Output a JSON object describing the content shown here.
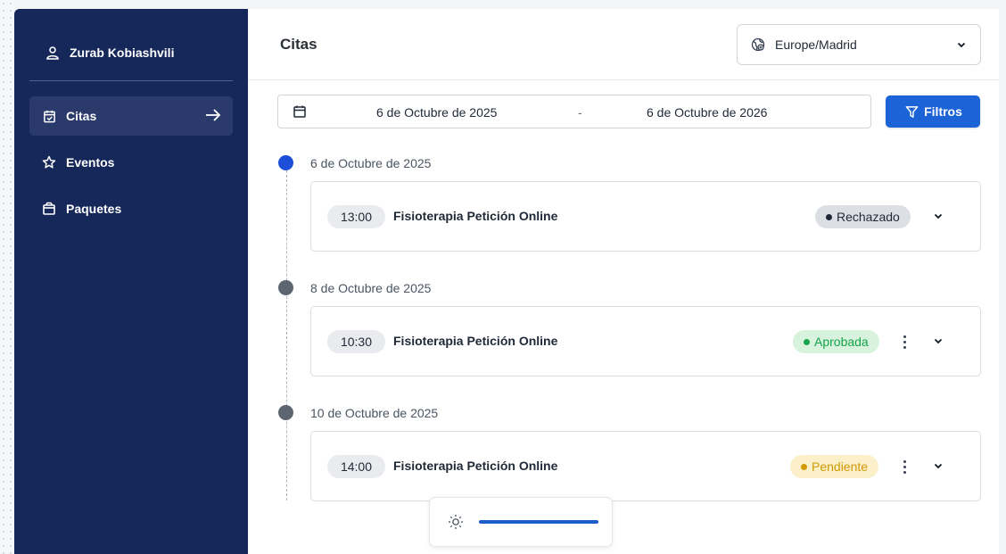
{
  "sidebar": {
    "user_name": "Zurab Kobiashvili",
    "items": [
      {
        "label": "Citas",
        "icon": "calendar-check-icon",
        "active": true
      },
      {
        "label": "Eventos",
        "icon": "star-icon",
        "active": false
      },
      {
        "label": "Paquetes",
        "icon": "package-icon",
        "active": false
      }
    ]
  },
  "header": {
    "title": "Citas",
    "timezone": "Europe/Madrid"
  },
  "filters": {
    "date_from": "6 de Octubre de 2025",
    "separator": "-",
    "date_to": "6 de Octubre de 2026",
    "filter_label": "Filtros"
  },
  "timeline": [
    {
      "date": "6 de Octubre de 2025",
      "time": "13:00",
      "title": "Fisioterapia Petición Online",
      "status": "Rechazado"
    },
    {
      "date": "8 de Octubre de 2025",
      "time": "10:30",
      "title": "Fisioterapia Petición Online",
      "status": "Aprobada"
    },
    {
      "date": "10 de Octubre de 2025",
      "time": "14:00",
      "title": "Fisioterapia Petición Online",
      "status": "Pendiente"
    }
  ],
  "colors": {
    "sidebar_bg": "#16285a",
    "primary": "#1d63d8",
    "approved": "#16a34a",
    "pending": "#d19a06",
    "rejected": "#1f2937"
  }
}
